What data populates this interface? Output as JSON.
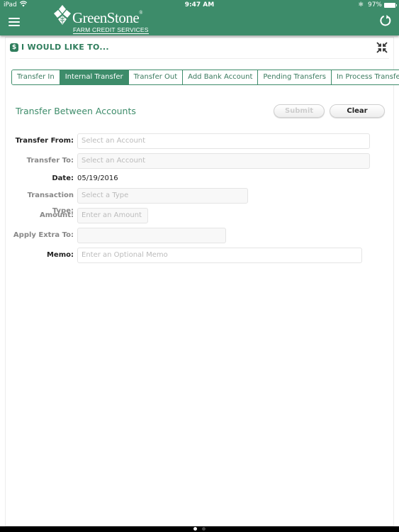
{
  "status_bar": {
    "carrier": "iPad",
    "time": "9:47 AM",
    "battery": "97%",
    "icons": [
      "wifi-icon",
      "bluetooth-icon",
      "battery-icon"
    ]
  },
  "header": {
    "brand": "GreenStone",
    "brand_reg": "®",
    "brand_sub": "FARM CREDIT SERVICES",
    "menu_icon": "hamburger-icon",
    "refresh_icon": "refresh-icon",
    "color": "#3d8c6a"
  },
  "panel": {
    "title": "I WOULD LIKE TO...",
    "title_icon_glyph": "$",
    "collapse_icon": "collapse-icon"
  },
  "tabs": [
    {
      "label": "Transfer In",
      "active": false
    },
    {
      "label": "Internal Transfer",
      "active": true
    },
    {
      "label": "Transfer Out",
      "active": false
    },
    {
      "label": "Add Bank Account",
      "active": false
    },
    {
      "label": "Pending Transfers",
      "active": false
    },
    {
      "label": "In Process Transfers",
      "active": false
    }
  ],
  "form": {
    "title": "Transfer Between Accounts",
    "submit_label": "Submit",
    "clear_label": "Clear",
    "fields": {
      "transfer_from": {
        "label": "Transfer From:",
        "placeholder": "Select an Account"
      },
      "transfer_to": {
        "label": "Transfer To:",
        "placeholder": "Select an Account"
      },
      "date": {
        "label": "Date:",
        "value": "05/19/2016"
      },
      "transaction_type": {
        "label": "Transaction Type:",
        "placeholder": "Select a Type"
      },
      "amount": {
        "label": "Amount:",
        "placeholder": "Enter an Amount"
      },
      "apply_extra_to": {
        "label": "Apply Extra To:",
        "placeholder": ""
      },
      "memo": {
        "label": "Memo:",
        "placeholder": "Enter an Optional Memo"
      }
    }
  },
  "page_indicator": {
    "pages": 2,
    "current": 1
  }
}
